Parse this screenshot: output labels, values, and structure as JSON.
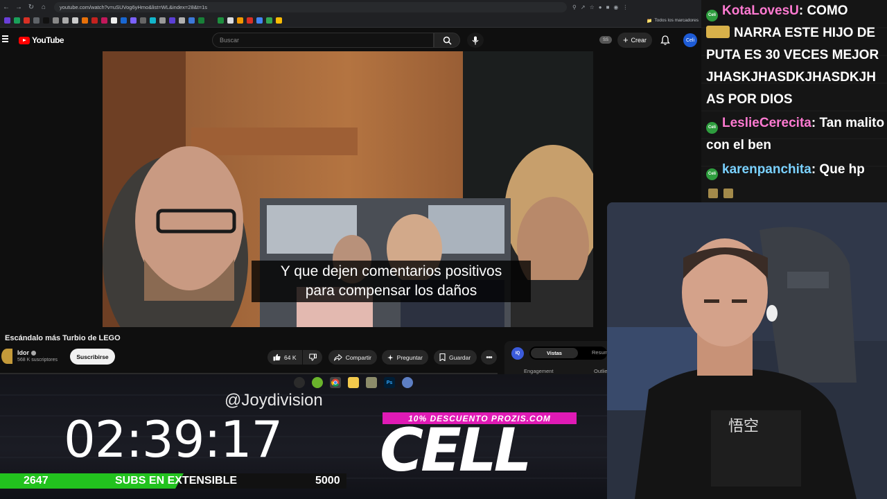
{
  "browser": {
    "url": "youtube.com/watch?v=uSUVog6yHmo&list=WL&index=28&t=1s",
    "bookmarks_all": "Todos los marcadores"
  },
  "youtube": {
    "logo": "YouTube",
    "search_placeholder": "Buscar",
    "ss_badge": "SS",
    "create_label": "Crear",
    "avatar_label": "Celi"
  },
  "video": {
    "subtitle_line1": "Y que dejen comentarios positivos",
    "subtitle_line2": "para compensar los daños",
    "title": "Escándalo más Turbio de LEGO",
    "channel": "Idor",
    "subscribers": "568 K suscriptores",
    "subscribe_label": "Suscribirse",
    "likes": "64 K",
    "share_label": "Compartir",
    "ask_label": "Preguntar",
    "save_label": "Guardar"
  },
  "iq_panel": {
    "icon": "IQ",
    "tab_active": "Vistas",
    "tab_other": "Resum",
    "label_engagement": "Engagement",
    "label_outliers": "Outlie"
  },
  "chat": {
    "messages": [
      {
        "user": "KotaLovesU",
        "text": ": COMO"
      },
      {
        "user": "",
        "text": "NARRA ESTE HIJO DE PUTA ES 30 VECES MEJOR JHASKJHASDKJHASDKJH AS POR DIOS"
      },
      {
        "user": "LeslieCerecita",
        "text": ": Tan malito con el ben"
      },
      {
        "user": "karenpanchita",
        "text": ": Que hp"
      }
    ],
    "badge_text": "Celi"
  },
  "overlay": {
    "donor": "@Joydivision",
    "timer": "02:39:17",
    "subs_current": "2647",
    "subs_label": "SUBS EN EXTENSIBLE",
    "subs_goal": "5000",
    "subs_fraction": 0.53,
    "promo": "10% DESCUENTO PROZIS.COM",
    "brand": "CELL"
  },
  "colors": {
    "youtube_red": "#ff0000",
    "progress_green": "#22c21e",
    "promo_pink": "#e01ab5",
    "chat_user_pink": "#ff7ad1",
    "chat_user_blue": "#7ad1ff"
  }
}
